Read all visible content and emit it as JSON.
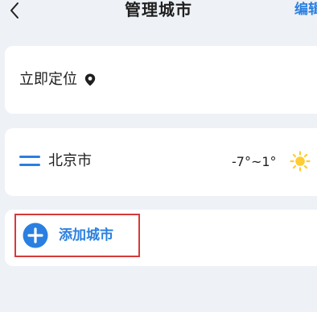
{
  "header": {
    "title": "管理城市",
    "edit_label": "编辑"
  },
  "locate": {
    "label": "立即定位"
  },
  "city": {
    "name": "北京市",
    "temperature": "-7°~1°",
    "weather_icon": "sun-icon"
  },
  "add": {
    "label": "添加城市"
  },
  "colors": {
    "accent": "#2a7fe0",
    "background": "#eef1f6",
    "card": "#ffffff",
    "highlight_border": "#d63a3a",
    "sun": "#ffcc33"
  }
}
